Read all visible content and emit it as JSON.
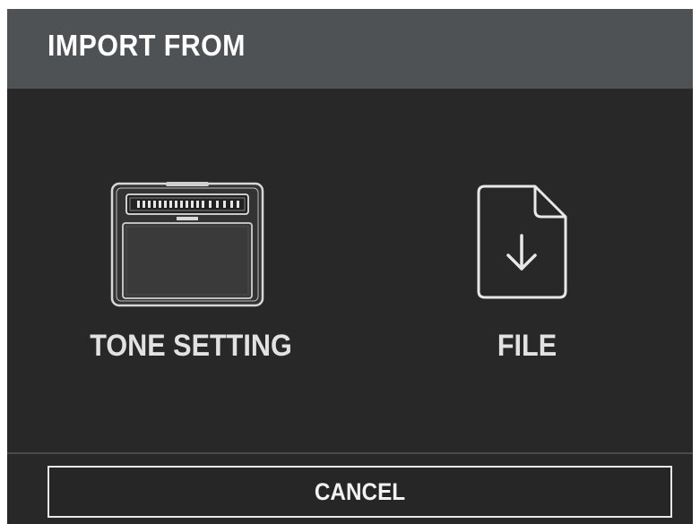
{
  "dialog": {
    "title": "IMPORT FROM",
    "options": [
      {
        "label": "TONE SETTING",
        "icon": "amplifier-icon"
      },
      {
        "label": "FILE",
        "icon": "file-download-icon"
      }
    ],
    "cancel_label": "CANCEL"
  },
  "colors": {
    "background": "#282828",
    "header": "#4f5255",
    "text": "#e2e2e2",
    "border": "#e8e8e8"
  }
}
